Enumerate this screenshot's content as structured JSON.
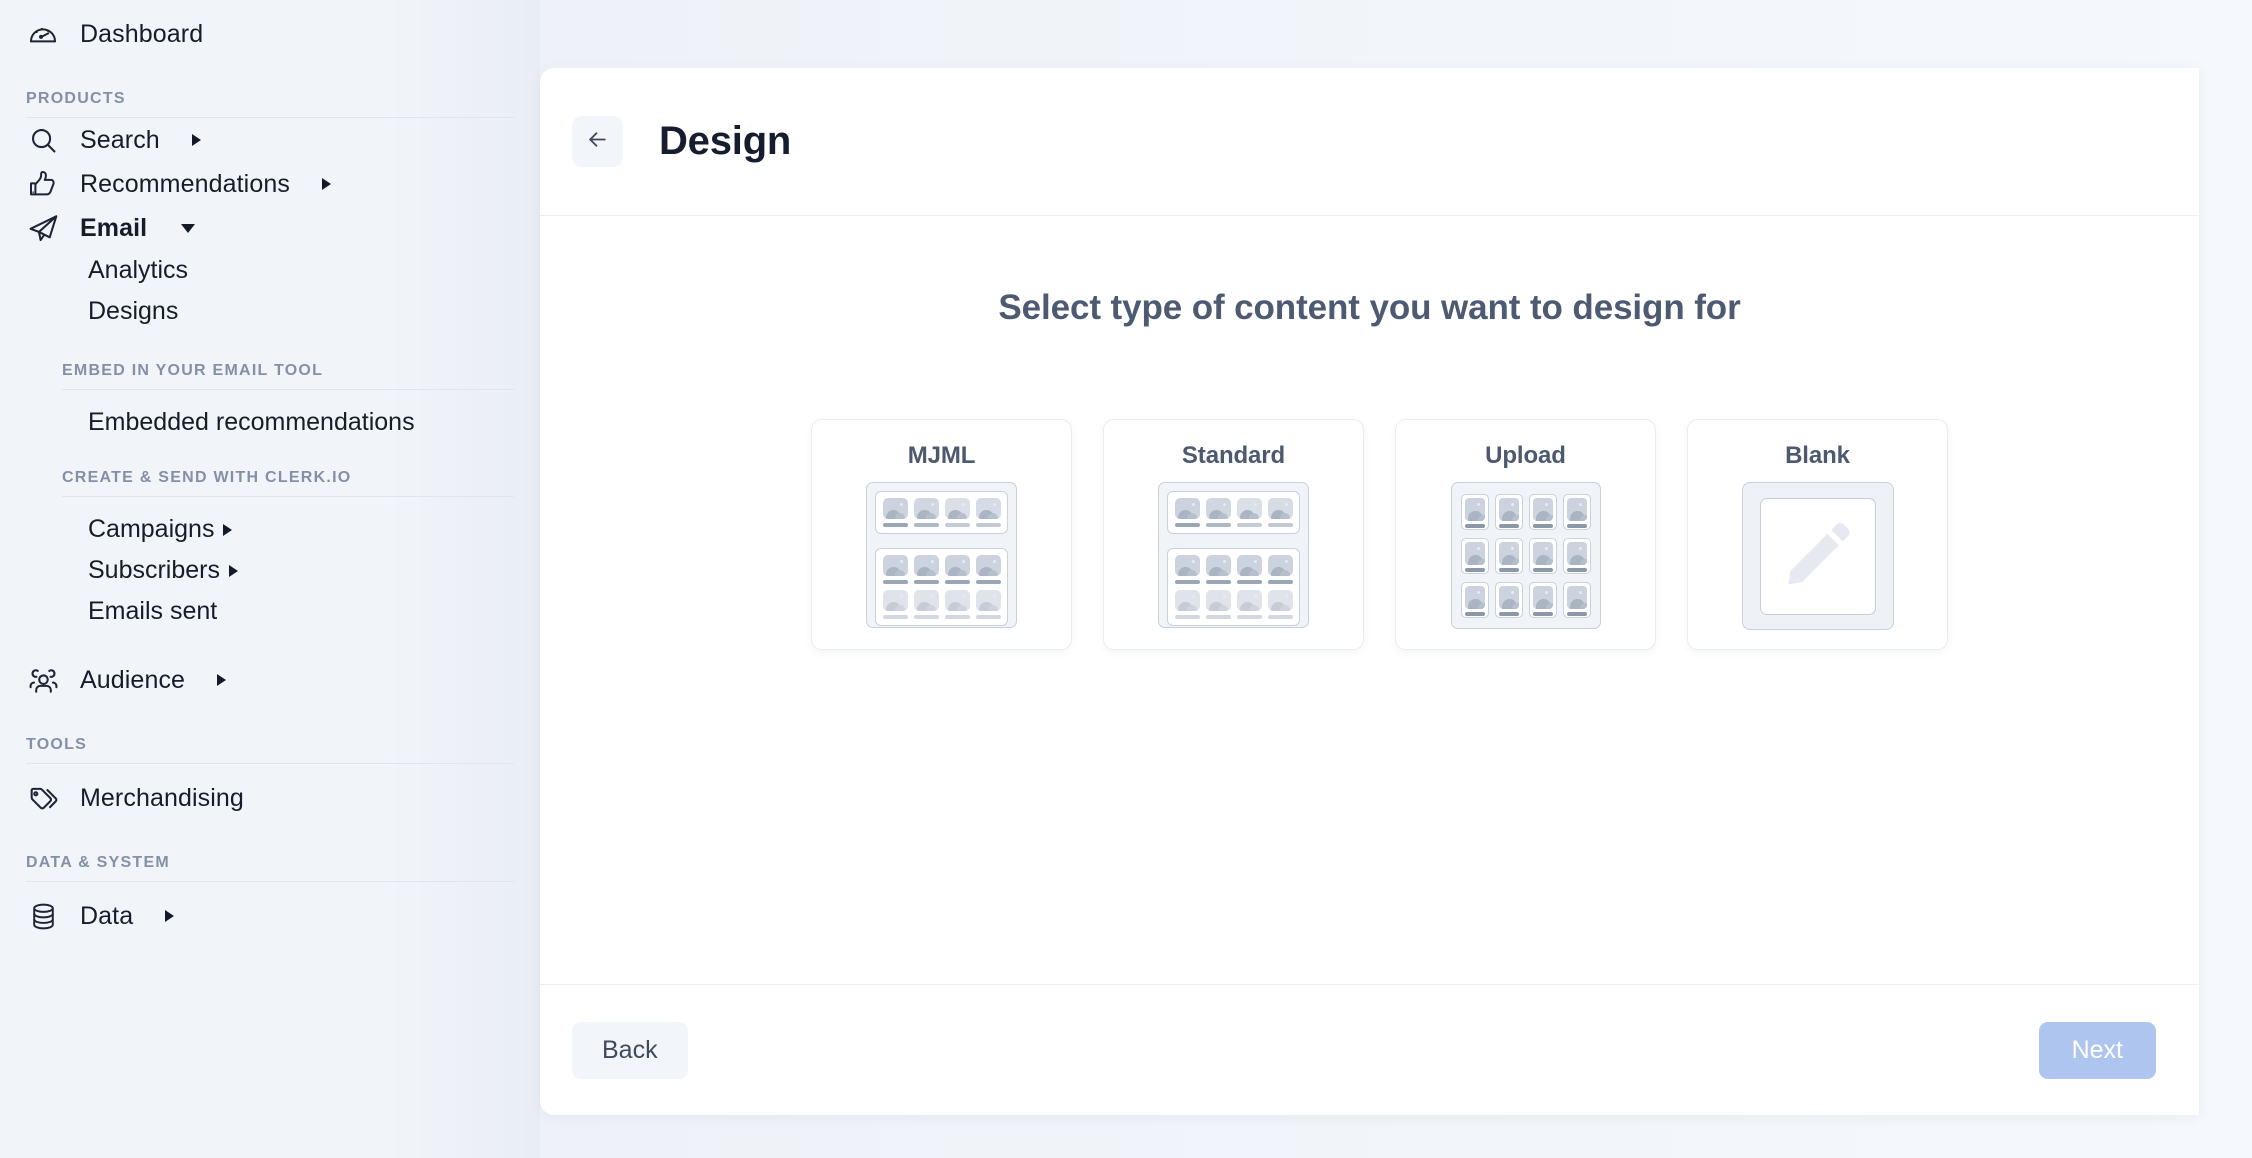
{
  "sidebar": {
    "dashboard": {
      "label": "Dashboard",
      "icon": "dashboard-gauge-icon"
    },
    "sections": [
      {
        "heading": "PRODUCTS",
        "items": [
          {
            "label": "Search",
            "icon": "search-icon",
            "caret": "right",
            "bold": false
          },
          {
            "label": "Recommendations",
            "icon": "thumbs-up-icon",
            "caret": "right",
            "bold": false
          },
          {
            "label": "Email",
            "icon": "paper-plane-icon",
            "caret": "down",
            "bold": true
          }
        ],
        "sub_items": [
          "Analytics",
          "Designs"
        ]
      },
      {
        "heading": "EMBED IN YOUR EMAIL TOOL",
        "sub_items": [
          "Embedded recommendations"
        ]
      },
      {
        "heading": "CREATE & SEND WITH CLERK.IO",
        "sub_items_caret": [
          {
            "label": "Campaigns",
            "caret": "right"
          },
          {
            "label": "Subscribers",
            "caret": "right"
          },
          {
            "label": "Emails sent",
            "caret": "none"
          }
        ],
        "items": [
          {
            "label": "Audience",
            "icon": "users-icon",
            "caret": "right",
            "bold": false
          }
        ]
      },
      {
        "heading": "TOOLS",
        "items": [
          {
            "label": "Merchandising",
            "icon": "tag-icon",
            "caret": "none",
            "bold": false
          }
        ]
      },
      {
        "heading": "DATA & SYSTEM",
        "items": [
          {
            "label": "Data",
            "icon": "database-icon",
            "caret": "right",
            "bold": false
          }
        ]
      }
    ]
  },
  "panel": {
    "back_icon": "arrow-left-icon",
    "title": "Design",
    "prompt": "Select type of content you want to design for",
    "options": [
      {
        "title": "MJML",
        "thumb": "template-layout-thumbnail"
      },
      {
        "title": "Standard",
        "thumb": "template-layout-thumbnail"
      },
      {
        "title": "Upload",
        "thumb": "grid-of-cards-thumbnail"
      },
      {
        "title": "Blank",
        "thumb": "pencil-blank-thumbnail"
      }
    ],
    "footer": {
      "back_label": "Back",
      "next_label": "Next"
    }
  },
  "colors": {
    "sidebar_bg": "#f1f5fa",
    "panel_bg": "#ffffff",
    "text_primary": "#171c2b",
    "text_muted": "#8490a6",
    "heading_muted": "#4d5a72",
    "next_button": "#aec5f0",
    "back_button": "#f2f5fa",
    "thumb_frame": "#f0f3f8",
    "thumb_border": "#c8d0dc"
  }
}
